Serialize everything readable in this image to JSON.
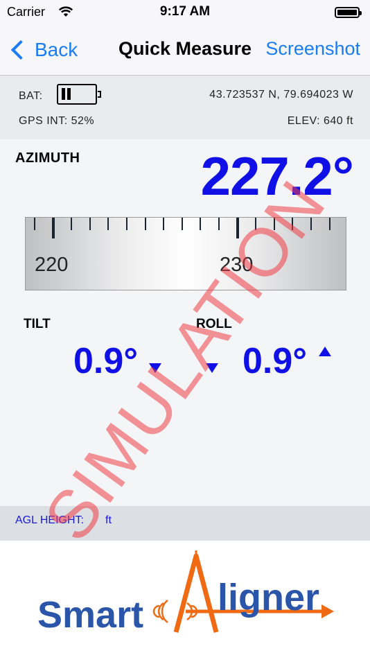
{
  "status_bar": {
    "carrier": "Carrier",
    "time": "9:17 AM"
  },
  "nav": {
    "back_label": "Back",
    "title": "Quick Measure",
    "screenshot_label": "Screenshot"
  },
  "info": {
    "bat_label": "BAT:",
    "coordinates": "43.723537 N,  79.694023 W",
    "gps_int": "GPS INT:  52%",
    "elevation": "ELEV:  640 ft"
  },
  "azimuth": {
    "label": "AZIMUTH",
    "value": "227.2°",
    "scale_labels": [
      "220",
      "230"
    ]
  },
  "tilt": {
    "label": "TILT",
    "value": "0.9°"
  },
  "roll": {
    "label": "ROLL",
    "value": "0.9°"
  },
  "agl": {
    "label": "AGL HEIGHT:",
    "unit": "ft"
  },
  "watermark": "SIMULATION",
  "logo": {
    "text_smart": "Smart",
    "text_aligner": "ligner",
    "brand_blue": "#2a55a8",
    "brand_orange": "#ef6a12"
  },
  "colors": {
    "accent_blue": "#1a7cf5",
    "value_blue": "#1010e6",
    "watermark_red": "#ee3c46"
  }
}
